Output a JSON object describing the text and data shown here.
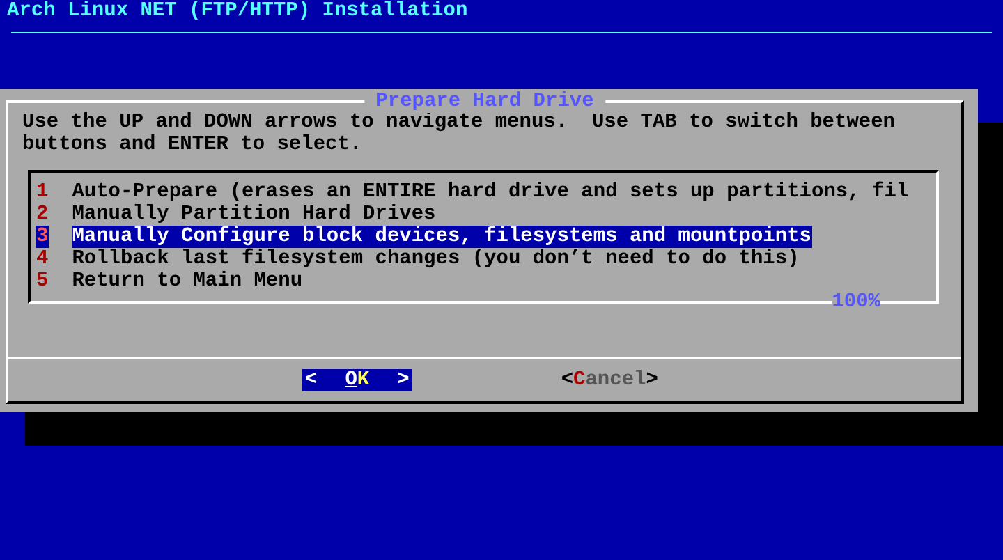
{
  "header": {
    "title": "Arch Linux NET (FTP/HTTP) Installation"
  },
  "dialog": {
    "title": "Prepare Hard Drive",
    "instructions": "Use the UP and DOWN arrows to navigate menus.  Use TAB to switch between buttons and ENTER to select.",
    "menu": [
      {
        "number": "1",
        "text": "Auto-Prepare (erases an ENTIRE hard drive and sets up partitions, fil",
        "selected": false
      },
      {
        "number": "2",
        "text": "Manually Partition Hard Drives",
        "selected": false
      },
      {
        "number": "3",
        "text": "Manually Configure block devices, filesystems and mountpoints",
        "selected": true
      },
      {
        "number": "4",
        "text": "Rollback last filesystem changes (you don’t need to do this)",
        "selected": false
      },
      {
        "number": "5",
        "text": "Return to Main Menu",
        "selected": false
      }
    ],
    "scroll_percent": "100%",
    "buttons": [
      {
        "open": "<",
        "label": "OK",
        "close": ">",
        "selected": true
      },
      {
        "open": "<",
        "label": "Cancel",
        "close": ">",
        "selected": false
      }
    ]
  }
}
